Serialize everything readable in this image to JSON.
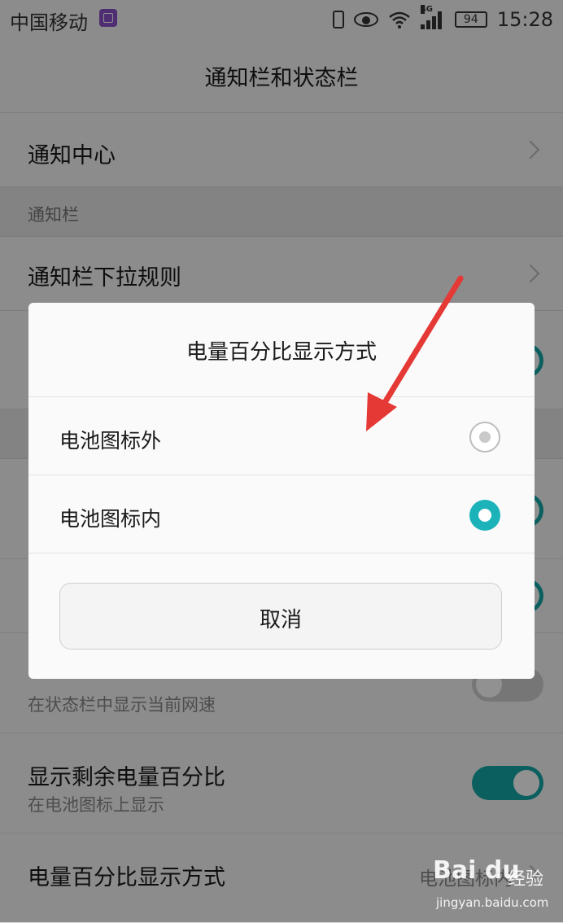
{
  "status_bar": {
    "carrier": "中国移动",
    "network": "4G",
    "battery": "94",
    "time": "15:28",
    "icons": [
      "gallery-icon",
      "vibrate-icon",
      "eye-icon",
      "wifi-icon",
      "signal-icon",
      "battery-icon"
    ]
  },
  "header": {
    "title": "通知栏和状态栏"
  },
  "settings": {
    "notification_center": "通知中心",
    "section_notification_bar": "通知栏",
    "pull_down_rules": "通知栏下拉规则",
    "network_speed_sub": "在状态栏中显示当前网速",
    "show_percent_title": "显示剩余电量百分比",
    "show_percent_sub": "在电池图标上显示",
    "percent_mode_title": "电量百分比显示方式",
    "percent_mode_value": "电池图标内"
  },
  "dialog": {
    "title": "电量百分比显示方式",
    "options": [
      {
        "label": "电池图标外",
        "selected": false
      },
      {
        "label": "电池图标内",
        "selected": true
      }
    ],
    "cancel": "取消"
  },
  "watermark": {
    "brand": "Bai du",
    "text": "经验",
    "url": "jingyan.baidu.com"
  },
  "colors": {
    "accent": "#1bb3b9",
    "arrow": "#e53935"
  }
}
